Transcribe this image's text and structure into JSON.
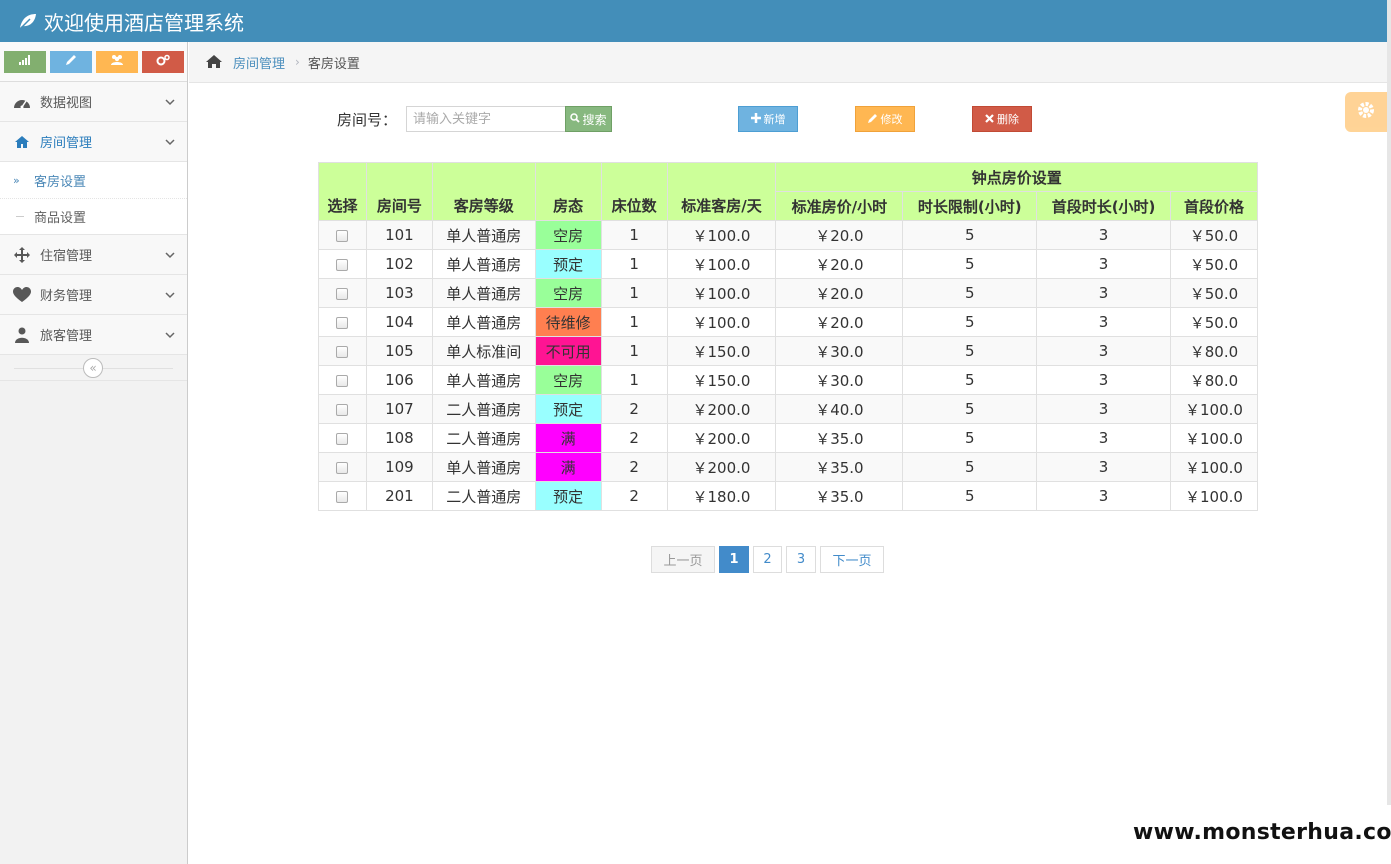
{
  "app": {
    "title": "欢迎使用酒店管理系统"
  },
  "colors": {
    "header": "#438eb9",
    "table_header": "#ccff99",
    "status_empty": "#99ff99",
    "status_reserved": "#99ffff",
    "status_repair": "#ff7f50",
    "status_unavailable": "#ff1493",
    "status_full": "#ff00ff"
  },
  "sidebar": {
    "shortcuts": [
      {
        "icon": "signal-icon"
      },
      {
        "icon": "pencil-icon"
      },
      {
        "icon": "users-icon"
      },
      {
        "icon": "cogs-icon"
      }
    ],
    "items": [
      {
        "label": "数据视图",
        "icon": "dashboard-icon"
      },
      {
        "label": "房间管理",
        "icon": "home-icon"
      },
      {
        "label": "住宿管理",
        "icon": "move-icon"
      },
      {
        "label": "财务管理",
        "icon": "heart-icon"
      },
      {
        "label": "旅客管理",
        "icon": "user-icon"
      }
    ],
    "subitems": [
      {
        "label": "客房设置",
        "active": true
      },
      {
        "label": "商品设置"
      }
    ]
  },
  "breadcrumb": {
    "parent": "房间管理",
    "current": "客房设置"
  },
  "search": {
    "label": "房间号：",
    "placeholder": "请输入关键字",
    "button": "搜索"
  },
  "actions": {
    "add": "新增",
    "edit": "修改",
    "delete": "删除"
  },
  "table": {
    "group_header": "钟点房价设置",
    "columns": [
      "选择",
      "房间号",
      "客房等级",
      "房态",
      "床位数",
      "标准客房/天",
      "标准房价/小时",
      "时长限制(小时)",
      "首段时长(小时)",
      "首段价格"
    ],
    "rows": [
      {
        "room": "101",
        "level": "单人普通房",
        "status": "空房",
        "status_color": "#99ff99",
        "beds": "1",
        "day_price": "￥100.0",
        "hour_price": "￥20.0",
        "limit": "5",
        "first_hours": "3",
        "first_price": "￥50.0"
      },
      {
        "room": "102",
        "level": "单人普通房",
        "status": "预定",
        "status_color": "#99ffff",
        "beds": "1",
        "day_price": "￥100.0",
        "hour_price": "￥20.0",
        "limit": "5",
        "first_hours": "3",
        "first_price": "￥50.0"
      },
      {
        "room": "103",
        "level": "单人普通房",
        "status": "空房",
        "status_color": "#99ff99",
        "beds": "1",
        "day_price": "￥100.0",
        "hour_price": "￥20.0",
        "limit": "5",
        "first_hours": "3",
        "first_price": "￥50.0"
      },
      {
        "room": "104",
        "level": "单人普通房",
        "status": "待维修",
        "status_color": "#ff7f50",
        "beds": "1",
        "day_price": "￥100.0",
        "hour_price": "￥20.0",
        "limit": "5",
        "first_hours": "3",
        "first_price": "￥50.0"
      },
      {
        "room": "105",
        "level": "单人标准间",
        "status": "不可用",
        "status_color": "#ff1493",
        "beds": "1",
        "day_price": "￥150.0",
        "hour_price": "￥30.0",
        "limit": "5",
        "first_hours": "3",
        "first_price": "￥80.0"
      },
      {
        "room": "106",
        "level": "单人普通房",
        "status": "空房",
        "status_color": "#99ff99",
        "beds": "1",
        "day_price": "￥150.0",
        "hour_price": "￥30.0",
        "limit": "5",
        "first_hours": "3",
        "first_price": "￥80.0"
      },
      {
        "room": "107",
        "level": "二人普通房",
        "status": "预定",
        "status_color": "#99ffff",
        "beds": "2",
        "day_price": "￥200.0",
        "hour_price": "￥40.0",
        "limit": "5",
        "first_hours": "3",
        "first_price": "￥100.0"
      },
      {
        "room": "108",
        "level": "二人普通房",
        "status": "满",
        "status_color": "#ff00ff",
        "beds": "2",
        "day_price": "￥200.0",
        "hour_price": "￥35.0",
        "limit": "5",
        "first_hours": "3",
        "first_price": "￥100.0"
      },
      {
        "room": "109",
        "level": "单人普通房",
        "status": "满",
        "status_color": "#ff00ff",
        "beds": "2",
        "day_price": "￥200.0",
        "hour_price": "￥35.0",
        "limit": "5",
        "first_hours": "3",
        "first_price": "￥100.0"
      },
      {
        "room": "201",
        "level": "二人普通房",
        "status": "预定",
        "status_color": "#99ffff",
        "beds": "2",
        "day_price": "￥180.0",
        "hour_price": "￥35.0",
        "limit": "5",
        "first_hours": "3",
        "first_price": "￥100.0"
      }
    ]
  },
  "pagination": {
    "prev": "上一页",
    "pages": [
      "1",
      "2",
      "3"
    ],
    "current": "1",
    "next": "下一页"
  },
  "watermark": "www.monsterhua.com"
}
